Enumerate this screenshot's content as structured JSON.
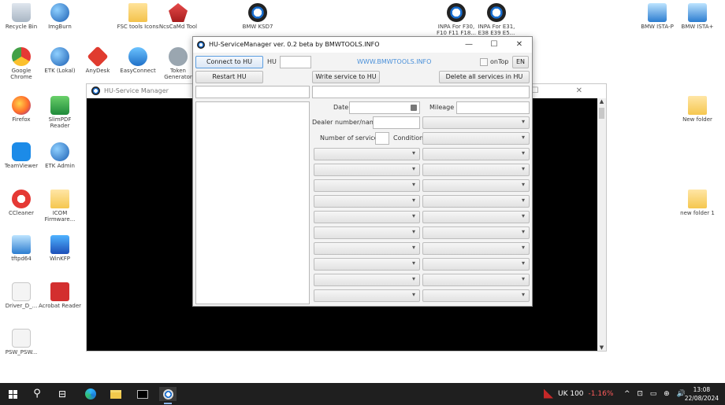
{
  "desktop": {
    "icons": [
      {
        "label": "Recycle Bin",
        "icon": "recycle-bin-icon"
      },
      {
        "label": "ImgBurn",
        "icon": "imgburn-icon"
      },
      {
        "label": "FSC tools Icons",
        "icon": "fsc-tools-icon"
      },
      {
        "label": "NcsCaMd Tool",
        "icon": "ncs-tool-icon"
      },
      {
        "label": "BMW KSD7",
        "icon": "bmw-ksd-icon"
      },
      {
        "label": "INPA For F30, F10 F11 F18...",
        "icon": "inpa-f30-icon"
      },
      {
        "label": "INPA For E31, E38 E39 E5...",
        "icon": "inpa-e31-icon"
      },
      {
        "label": "BMW ISTA-P",
        "icon": "ista-p-icon"
      },
      {
        "label": "BMW ISTA+",
        "icon": "ista-plus-icon"
      },
      {
        "label": "Google Chrome",
        "icon": "chrome-icon"
      },
      {
        "label": "ETK (Lokal)",
        "icon": "etk-icon"
      },
      {
        "label": "AnyDesk",
        "icon": "anydesk-icon"
      },
      {
        "label": "EasyConnect",
        "icon": "easyconnect-icon"
      },
      {
        "label": "Token Generator",
        "icon": "token-icon"
      },
      {
        "label": "Firefox",
        "icon": "firefox-icon"
      },
      {
        "label": "SlimPDF Reader",
        "icon": "slimpdf-icon"
      },
      {
        "label": "TeamViewer",
        "icon": "teamviewer-icon"
      },
      {
        "label": "ETK Admin",
        "icon": "etk-admin-icon"
      },
      {
        "label": "CCleaner",
        "icon": "ccleaner-icon"
      },
      {
        "label": "ICOM Firmware...",
        "icon": "icom-icon"
      },
      {
        "label": "tftpd64",
        "icon": "tftpd-icon"
      },
      {
        "label": "WinKFP",
        "icon": "winkfp-icon"
      },
      {
        "label": "Driver_D_...",
        "icon": "driver-icon"
      },
      {
        "label": "Acrobat Reader",
        "icon": "acrobat-icon"
      },
      {
        "label": "PSW_PSW...",
        "icon": "psw-icon"
      },
      {
        "label": "New folder",
        "icon": "folder-icon"
      },
      {
        "label": "new folder 1",
        "icon": "folder-icon"
      }
    ]
  },
  "console": {
    "title": "HU-Service Manager",
    "controls": "—  ☐  ✕"
  },
  "app": {
    "title": "HU-ServiceManager ver. 0.2 beta by BMWTOOLS.INFO",
    "controls": {
      "minimize": "—",
      "maximize": "☐",
      "close": "✕"
    },
    "toolbar": {
      "connect": "Connect to HU",
      "hu_label": "HU",
      "hu_value": "",
      "website": "WWW.BMWTOOLS.INFO",
      "ontop": "onTop",
      "language": "EN",
      "restart": "Restart HU",
      "write": "Write service to HU",
      "delete_all": "Delete all services in HU"
    },
    "form": {
      "date_label": "Date",
      "mileage_label": "Mileage",
      "dealer_label": "Dealer number/name",
      "services_label": "Number of services",
      "condition_label": "Condition"
    }
  },
  "taskbar": {
    "ticker_symbol": "UK 100",
    "ticker_change": "-1.16%",
    "tray": "^ ⊡ ▭ ⊕ 🔊",
    "time": "13:08",
    "date": "22/08/2024"
  }
}
